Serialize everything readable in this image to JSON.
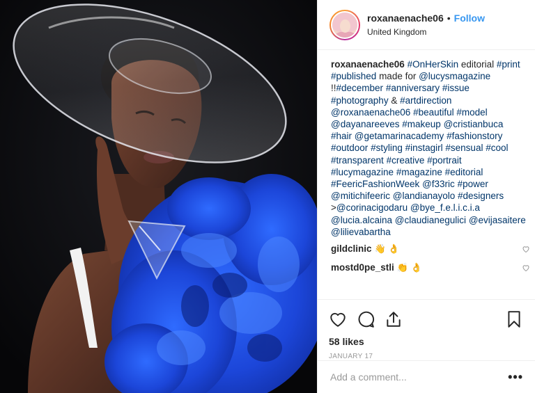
{
  "post": {
    "username": "roxanaenache06",
    "follow_label": "Follow",
    "separator": "•",
    "location": "United Kingdom",
    "avatar_icon": "avatar-photo",
    "accent_color": "#3897f0",
    "hashtag_color": "#003569"
  },
  "caption": {
    "author": "roxanaenache06",
    "tokens": [
      {
        "text": "#OnHerSkin",
        "tag": true
      },
      {
        "text": " editorial ",
        "tag": false
      },
      {
        "text": "#print",
        "tag": true
      },
      {
        "text": " ",
        "tag": false
      },
      {
        "text": "#published",
        "tag": true
      },
      {
        "text": " made for ",
        "tag": false
      },
      {
        "text": "@lucysmagazine",
        "tag": true
      },
      {
        "text": " !!",
        "tag": false
      },
      {
        "text": "#december",
        "tag": true
      },
      {
        "text": " ",
        "tag": false
      },
      {
        "text": "#anniversary",
        "tag": true
      },
      {
        "text": " ",
        "tag": false
      },
      {
        "text": "#issue",
        "tag": true
      },
      {
        "text": " ",
        "tag": false
      },
      {
        "text": "#photography",
        "tag": true
      },
      {
        "text": " & ",
        "tag": false
      },
      {
        "text": "#artdirection",
        "tag": true
      },
      {
        "text": " ",
        "tag": false
      },
      {
        "text": "@roxanaenache06",
        "tag": true
      },
      {
        "text": " ",
        "tag": false
      },
      {
        "text": "#beautiful",
        "tag": true
      },
      {
        "text": " ",
        "tag": false
      },
      {
        "text": "#model",
        "tag": true
      },
      {
        "text": " ",
        "tag": false
      },
      {
        "text": "@dayanareeves",
        "tag": true
      },
      {
        "text": " ",
        "tag": false
      },
      {
        "text": "#makeup",
        "tag": true
      },
      {
        "text": " ",
        "tag": false
      },
      {
        "text": "@cristianbuca",
        "tag": true
      },
      {
        "text": " ",
        "tag": false
      },
      {
        "text": "#hair",
        "tag": true
      },
      {
        "text": " ",
        "tag": false
      },
      {
        "text": "@getamarinacademy",
        "tag": true
      },
      {
        "text": " ",
        "tag": false
      },
      {
        "text": "#fashionstory",
        "tag": true
      },
      {
        "text": " ",
        "tag": false
      },
      {
        "text": "#outdoor",
        "tag": true
      },
      {
        "text": " ",
        "tag": false
      },
      {
        "text": "#styling",
        "tag": true
      },
      {
        "text": " ",
        "tag": false
      },
      {
        "text": "#instagirl",
        "tag": true
      },
      {
        "text": " ",
        "tag": false
      },
      {
        "text": "#sensual",
        "tag": true
      },
      {
        "text": " ",
        "tag": false
      },
      {
        "text": "#cool",
        "tag": true
      },
      {
        "text": " ",
        "tag": false
      },
      {
        "text": "#transparent",
        "tag": true
      },
      {
        "text": " ",
        "tag": false
      },
      {
        "text": "#creative",
        "tag": true
      },
      {
        "text": " ",
        "tag": false
      },
      {
        "text": "#portrait",
        "tag": true
      },
      {
        "text": " ",
        "tag": false
      },
      {
        "text": "#lucymagazine",
        "tag": true
      },
      {
        "text": " ",
        "tag": false
      },
      {
        "text": "#magazine",
        "tag": true
      },
      {
        "text": " ",
        "tag": false
      },
      {
        "text": "#editorial",
        "tag": true
      },
      {
        "text": " ",
        "tag": false
      },
      {
        "text": "#FeericFashionWeek",
        "tag": true
      },
      {
        "text": " ",
        "tag": false
      },
      {
        "text": "@f33ric",
        "tag": true
      },
      {
        "text": " ",
        "tag": false
      },
      {
        "text": "#power",
        "tag": true
      },
      {
        "text": " ",
        "tag": false
      },
      {
        "text": "@mitichifeeric",
        "tag": true
      },
      {
        "text": " ",
        "tag": false
      },
      {
        "text": "@landianayolo",
        "tag": true
      },
      {
        "text": " ",
        "tag": false
      },
      {
        "text": "#designers",
        "tag": true
      },
      {
        "text": " >",
        "tag": false
      },
      {
        "text": "@corinacigodaru",
        "tag": true
      },
      {
        "text": " ",
        "tag": false
      },
      {
        "text": "@bye_f.e.l.i.c.i.a",
        "tag": true
      },
      {
        "text": " ",
        "tag": false
      },
      {
        "text": "@lucia.alcaina",
        "tag": true
      },
      {
        "text": " ",
        "tag": false
      },
      {
        "text": "@claudianegulici",
        "tag": true
      },
      {
        "text": " ",
        "tag": false
      },
      {
        "text": "@evijasaitere",
        "tag": true
      },
      {
        "text": " ",
        "tag": false
      },
      {
        "text": "@lilievabartha",
        "tag": true
      }
    ]
  },
  "comments": [
    {
      "author": "gildclinic",
      "text": "👋 👌"
    },
    {
      "author": "mostd0pe_stli",
      "text": "👏 👌"
    }
  ],
  "actions": {
    "icons": [
      "heart-icon",
      "comment-icon",
      "share-icon",
      "bookmark-icon"
    ],
    "likes": "58 likes",
    "date": "JANUARY 17"
  },
  "add_comment": {
    "placeholder": "Add a comment...",
    "more_label": "•••"
  }
}
